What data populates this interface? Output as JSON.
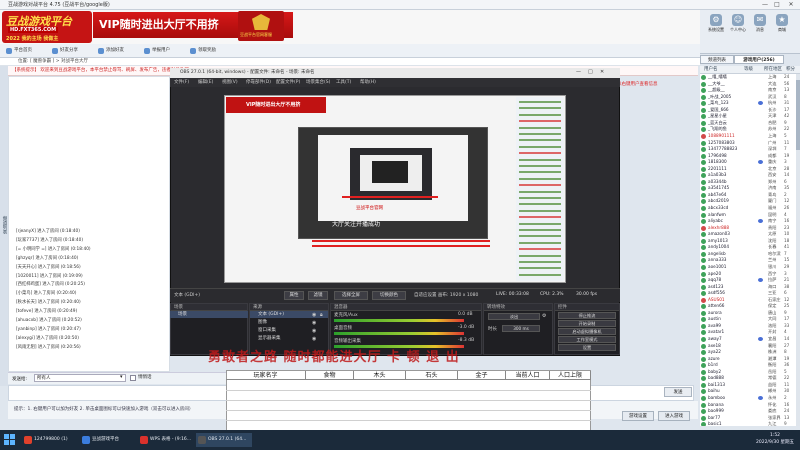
{
  "app": {
    "title": "豆战游戏对战平台 4.75 (豆战平台/google版)",
    "window_controls": [
      "—",
      "□",
      "✕"
    ]
  },
  "banner": {
    "logo_main": "豆战游戏平台",
    "logo_url": "HD.FXT365.COM",
    "logo_slogan": "2022 我的主场 我做主",
    "vip_text": "VIP随时进出大厅不用挤",
    "crest_caption": "豆战平台官网客服"
  },
  "top_icons": [
    {
      "name": "settings-icon",
      "label": "系统设置"
    },
    {
      "name": "user-icon",
      "label": "个人中心"
    },
    {
      "name": "message-icon",
      "label": "消息"
    },
    {
      "name": "shop-icon",
      "label": "商城"
    }
  ],
  "toolbar": [
    {
      "label": "平台首页"
    },
    {
      "label": "好友分享"
    },
    {
      "label": "添加好友"
    },
    {
      "label": "举报用户"
    },
    {
      "label": "领取奖励"
    },
    {
      "label": "战绩查看"
    }
  ],
  "nav_row": "位置:  [ 魔兽争霸 ] > 对战平台大厅",
  "ribbon": {
    "text": "【系统提示】 欢迎来到豆战游戏平台，本平台禁止辱骂、刷屏、发布广告，违者封号处理 ...",
    "right_text": "【提示】您可以右键用户查看信息"
  },
  "left_strip": "频道列表",
  "chat_lines": [
    "[rjeanyX] 进入了房间 (0:18:40)",
    "[玩家7737] 进入了房间 (0:18:40)",
    "[= 小明同学 =] 进入了房间 (0:18:40)",
    "[ghzyqr] 进入了房间 (0:18:40)",
    "[天天开心] 进入了房间 (0:18:56)",
    "[1020011] 进入了房间 (0:19:09)",
    "[西红柿鸡蛋] 进入了房间 (0:20:25)",
    "[小菜鸟] 进入了房间 (0:20:40)",
    "[秋水长天] 进入了房间 (0:20:40)",
    "[tofeve] 进入了房间 (0:20:49)",
    "[ahuacxb] 进入了房间 (0:20:52)",
    "[yanbinp] 进入了房间 (0:20:47)",
    "[alexygi] 进入了房间 (0:20:50)",
    "[风雨无阻] 进入了房间 (0:20:56)"
  ],
  "chat_bar": {
    "label": "发送给:",
    "select_value": "所有人",
    "checkbox_label": "悄悄话",
    "send_label": "发送"
  },
  "hint": {
    "text": "提示：1. 右键用户可以加为好友   2. 单击桌面图标可以快速加入游戏（双击可以进入房间）",
    "buttons": [
      "游戏设置",
      "进入游戏"
    ]
  },
  "obs": {
    "title": "OBS 27.0.1 (64-bit, windows) - 配置文件: 未命名 - 场景: 未命名",
    "menu": [
      "文件(F)",
      "编辑(E)",
      "视图(V)",
      "停靠部件(D)",
      "配置文件(P)",
      "场景集合(S)",
      "工具(T)",
      "帮助(H)"
    ],
    "preview_banner": "VIP随时进出大厅不用挤",
    "preview_caption": "大厅关注开播成功",
    "preview_subcaption": "豆战平台官网",
    "controls": {
      "source_label": "文本 (GDI+)",
      "props_btn": "属性",
      "filter_btn": "滤镜",
      "prev_source_btn": "选择全屏",
      "next_source_btn": "切换颜色",
      "stats_text": "自适应设置  画布: 1920 x 1080"
    },
    "docks": {
      "scenes": {
        "title": "场景",
        "items": [
          "场景"
        ]
      },
      "sources": {
        "title": "来源",
        "items": [
          "文本 (GDI+)",
          "图像",
          "窗口采集",
          "显示器采集"
        ]
      },
      "mixer": {
        "title": "混音器",
        "channels": [
          {
            "name": "麦克风/Aux",
            "value": "0.0 dB"
          },
          {
            "name": "桌面音频",
            "value": "-3.0 dB"
          },
          {
            "name": "音频输出采集",
            "value": "-8.3 dB"
          }
        ]
      },
      "transitions": {
        "title": "转场特效",
        "type": "淡出",
        "duration_label": "时长",
        "duration": "300 ms"
      },
      "controls_dock": {
        "title": "控件",
        "buttons": [
          "停止推流",
          "开始录制",
          "启动虚拟摄像机",
          "工作室模式",
          "设置",
          "退出"
        ]
      }
    },
    "status": {
      "live": "LIVE: 00:33:08",
      "rec": "REC: 00:00:00",
      "cpu": "CPU: 2.3%",
      "fps": "30.00 fps"
    }
  },
  "overlay_text": "勇敢者之路 随时都能进大厅 卡 顿 退 出",
  "sheet": {
    "headers": [
      "玩家名字",
      "食物",
      "木头",
      "石头",
      "金子",
      "当前人口",
      "人口上限"
    ]
  },
  "right_panel": {
    "tabs": [
      "频道列表",
      "游戏用户(256)"
    ],
    "columns": [
      "用户名",
      "等级",
      "所在地区",
      "积分"
    ],
    "users": [
      {
        "name": "__嘻_嘻嘻",
        "loc": "上海",
        "lv": "24"
      },
      {
        "name": "__大爷__",
        "loc": "大连",
        "lv": "56"
      },
      {
        "name": "__超级__",
        "loc": "南京",
        "lv": "13"
      },
      {
        "name": "_叶战_2005",
        "loc": "武汉",
        "lv": "8"
      },
      {
        "name": "_菜鸟_123",
        "loc": "杭州",
        "lv": "31"
      },
      {
        "name": "_爱国_666",
        "loc": "长沙",
        "lv": "17"
      },
      {
        "name": "_星星小星",
        "loc": "天津",
        "lv": "42"
      },
      {
        "name": "_蓝天白云",
        "loc": "合肥",
        "lv": "9"
      },
      {
        "name": "_飞翔的鱼",
        "loc": "苏州",
        "lv": "22"
      },
      {
        "name": "1088901111",
        "loc": "上海",
        "lv": "5",
        "red": true
      },
      {
        "name": "1257083803",
        "loc": "广州",
        "lv": "11"
      },
      {
        "name": "13477788823",
        "loc": "深圳",
        "lv": "7"
      },
      {
        "name": "1796498",
        "loc": "成都",
        "lv": "19"
      },
      {
        "name": "1818300",
        "loc": "重庆",
        "lv": "3"
      },
      {
        "name": "2201111",
        "loc": "北京",
        "lv": "28"
      },
      {
        "name": "a1a03b3",
        "loc": "西安",
        "lv": "14"
      },
      {
        "name": "a03344b",
        "loc": "郑州",
        "lv": "6"
      },
      {
        "name": "a3541745",
        "loc": "济南",
        "lv": "35"
      },
      {
        "name": "ab47e64",
        "loc": "青岛",
        "lv": "2"
      },
      {
        "name": "abcd2019",
        "loc": "厦门",
        "lv": "12"
      },
      {
        "name": "abcx33cd",
        "loc": "福州",
        "lv": "26"
      },
      {
        "name": "alanfwm",
        "loc": "昆明",
        "lv": "4"
      },
      {
        "name": "aliyabc",
        "loc": "南宁",
        "lv": "16"
      },
      {
        "name": "alexhr888",
        "loc": "贵阳",
        "lv": "23",
        "red": true
      },
      {
        "name": "amazon03",
        "loc": "太原",
        "lv": "10"
      },
      {
        "name": "amy1013",
        "loc": "沈阳",
        "lv": "18"
      },
      {
        "name": "andy1004",
        "loc": "长春",
        "lv": "41"
      },
      {
        "name": "angelisb",
        "loc": "哈尔滨",
        "lv": "7"
      },
      {
        "name": "anna333",
        "loc": "兰州",
        "lv": "15"
      },
      {
        "name": "aoe1001",
        "loc": "银川",
        "lv": "29"
      },
      {
        "name": "ape20",
        "loc": "西宁",
        "lv": "3"
      },
      {
        "name": "aqq78",
        "loc": "拉萨",
        "lv": "21"
      },
      {
        "name": "asd123",
        "loc": "海口",
        "lv": "38"
      },
      {
        "name": "asdf556",
        "loc": "三亚",
        "lv": "6"
      },
      {
        "name": "ASUS01",
        "loc": "石家庄",
        "lv": "12",
        "red": true
      },
      {
        "name": "atten66",
        "loc": "保定",
        "lv": "25"
      },
      {
        "name": "aurora",
        "loc": "唐山",
        "lv": "9"
      },
      {
        "name": "austin",
        "loc": "大同",
        "lv": "17"
      },
      {
        "name": "ava99",
        "loc": "洛阳",
        "lv": "33"
      },
      {
        "name": "avatar1",
        "loc": "开封",
        "lv": "4"
      },
      {
        "name": "away7",
        "loc": "宜昌",
        "lv": "14"
      },
      {
        "name": "axe18",
        "loc": "襄阳",
        "lv": "27"
      },
      {
        "name": "aya22",
        "loc": "株洲",
        "lv": "8"
      },
      {
        "name": "azure",
        "loc": "湘潭",
        "lv": "19"
      },
      {
        "name": "b1rd",
        "loc": "衡阳",
        "lv": "36"
      },
      {
        "name": "baby2",
        "loc": "岳阳",
        "lv": "5"
      },
      {
        "name": "bad888",
        "loc": "常德",
        "lv": "22"
      },
      {
        "name": "bai1313",
        "loc": "益阳",
        "lv": "11"
      },
      {
        "name": "baihu",
        "loc": "郴州",
        "lv": "30"
      },
      {
        "name": "bamboo",
        "loc": "永州",
        "lv": "2"
      },
      {
        "name": "banana",
        "loc": "怀化",
        "lv": "16"
      },
      {
        "name": "bao999",
        "loc": "娄底",
        "lv": "24"
      },
      {
        "name": "bar77",
        "loc": "张家界",
        "lv": "13"
      },
      {
        "name": "basic1",
        "loc": "九江",
        "lv": "9"
      }
    ]
  },
  "taskbar": {
    "items": [
      {
        "label": "124799800 (1)",
        "color": "#e0412c"
      },
      {
        "label": "豆战游戏平台",
        "color": "#3b7ddd"
      },
      {
        "label": "WPS 表格 - (9:16...",
        "color": "#d9312c"
      },
      {
        "label": "OBS 27.0.1 (64...",
        "color": "#555555"
      }
    ],
    "time": "1:52",
    "date": "2022/9/30 星期五"
  }
}
